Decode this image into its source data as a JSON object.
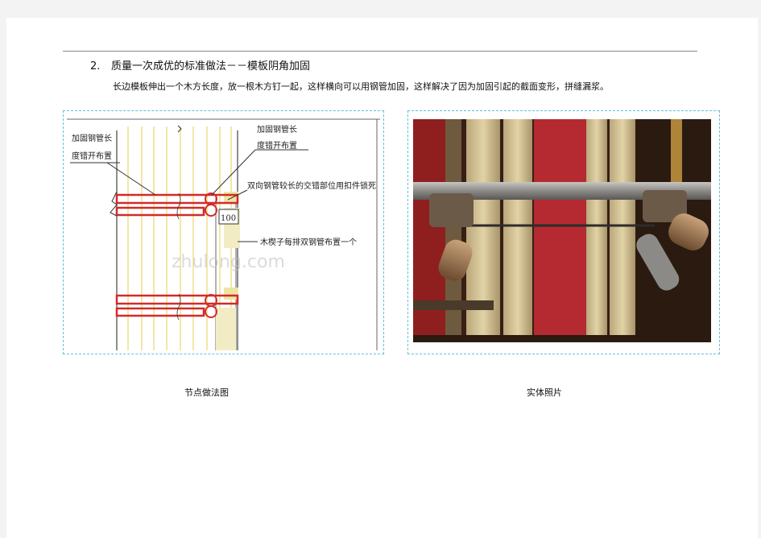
{
  "section": {
    "number": "2.",
    "title": "质量一次成优的标准做法－－模板阴角加固",
    "description": "长边模板伸出一个木方长度，放一根木方钉一起，这样横向可以用钢管加固，这样解决了因为加固引起的截面变形，拼缝漏浆。"
  },
  "diagram": {
    "label_left_1": "加固钢管长",
    "label_left_2": "度错开布置",
    "label_right_1": "加固钢管长",
    "label_right_2": "度错开布置",
    "label_clamp": "双向钢管较长的交错部位用扣件锁死",
    "label_dim": "100",
    "label_wood": "木楔子每排双钢管布置一个",
    "watermark": "zhulong.com"
  },
  "captions": {
    "left": "节点做法图",
    "right": "实体照片"
  },
  "colors": {
    "frame_border": "#5fc3d6",
    "pipe_red": "#d42a2a",
    "formwork_line": "#e8d86a"
  }
}
